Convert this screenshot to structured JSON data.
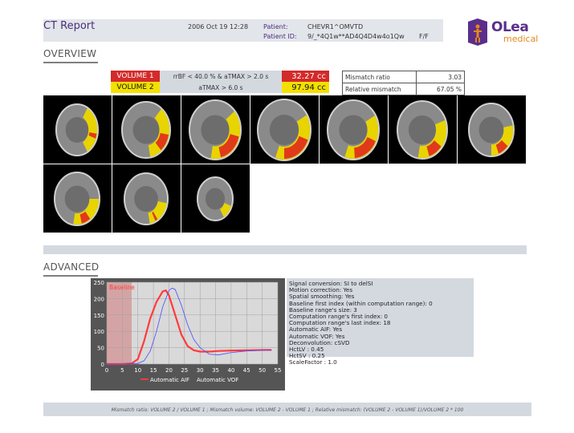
{
  "header": {
    "title": "CT Report",
    "date": "2006 Oct 19 12:28",
    "patient_label": "Patient:",
    "patient_value": "CHEVR1^OMVTD",
    "patient_id_label": "Patient ID:",
    "patient_id_value": "9/_*4Q1w**AD4Q4D4w4o1Qw",
    "sex": "F/F"
  },
  "logo": {
    "name": "OLea",
    "sub": "medical",
    "colors": {
      "primary": "#5a2e8a",
      "accent": "#e8861f"
    }
  },
  "overview": {
    "title": "OVERVIEW",
    "volumes": [
      {
        "name": "VOLUME 1",
        "condition": "rrBF < 40.0 % & aTMAX > 2.0 s",
        "value": "32.27 cc",
        "color": "#d32a2a"
      },
      {
        "name": "VOLUME 2",
        "condition": "aTMAX > 6.0 s",
        "value": "97.94 cc",
        "color": "#f4e000"
      }
    ],
    "mismatch": [
      {
        "label": "Mismatch ratio",
        "value": "3.03"
      },
      {
        "label": "Relative mismatch",
        "value": "67.05 %"
      }
    ]
  },
  "advanced": {
    "title": "ADVANCED",
    "info": [
      "Signal conversion: SI to delSI",
      "Motion correction: Yes",
      "Spatial smoothing: Yes",
      "Baseline first index (within computation range): 0",
      "Baseline range's size: 3",
      "Computation range's first index: 0",
      "Computation range's last index: 18",
      "Automatic AIF: Yes",
      "Automatic VOF: Yes",
      "Deconvolution: cSVD",
      "HctLV : 0.45",
      "HctSV : 0.25",
      "ScaleFactor : 1.0"
    ]
  },
  "footer": "Mismatch ratio: VOLUME 2 / VOLUME 1 ; Mismatch volume: VOLUME 2 - VOLUME 1 ; Relative mismatch: (VOLUME 2 - VOLUME 1)/VOLUME 2 * 100",
  "chart_data": {
    "type": "line",
    "xlim": [
      0,
      55
    ],
    "ylim": [
      0,
      250
    ],
    "xticks": [
      0,
      5,
      10,
      15,
      20,
      25,
      30,
      35,
      40,
      45,
      50,
      55
    ],
    "yticks": [
      0,
      50,
      100,
      150,
      200,
      250
    ],
    "baseline": {
      "label": "Baseline",
      "x_range": [
        0,
        8
      ]
    },
    "grid": true,
    "legend_position": "bottom",
    "series": [
      {
        "name": "Automatic AIF",
        "color": "#ff3b3b",
        "x": [
          0,
          5,
          8,
          10,
          12,
          14,
          16,
          18,
          19,
          20,
          22,
          24,
          26,
          28,
          30,
          33,
          36,
          40,
          45,
          50,
          53
        ],
        "y": [
          0,
          0,
          2,
          15,
          70,
          140,
          190,
          222,
          225,
          210,
          150,
          90,
          55,
          42,
          38,
          38,
          40,
          41,
          42,
          43,
          43
        ]
      },
      {
        "name": "Automatic VOF",
        "color": "#4a4aff",
        "x": [
          0,
          5,
          10,
          12,
          14,
          16,
          18,
          20,
          21,
          22,
          24,
          26,
          28,
          30,
          33,
          36,
          40,
          45,
          50,
          53
        ],
        "y": [
          0,
          0,
          2,
          10,
          40,
          100,
          175,
          225,
          232,
          228,
          180,
          120,
          75,
          50,
          30,
          28,
          35,
          40,
          42,
          43
        ]
      }
    ]
  }
}
